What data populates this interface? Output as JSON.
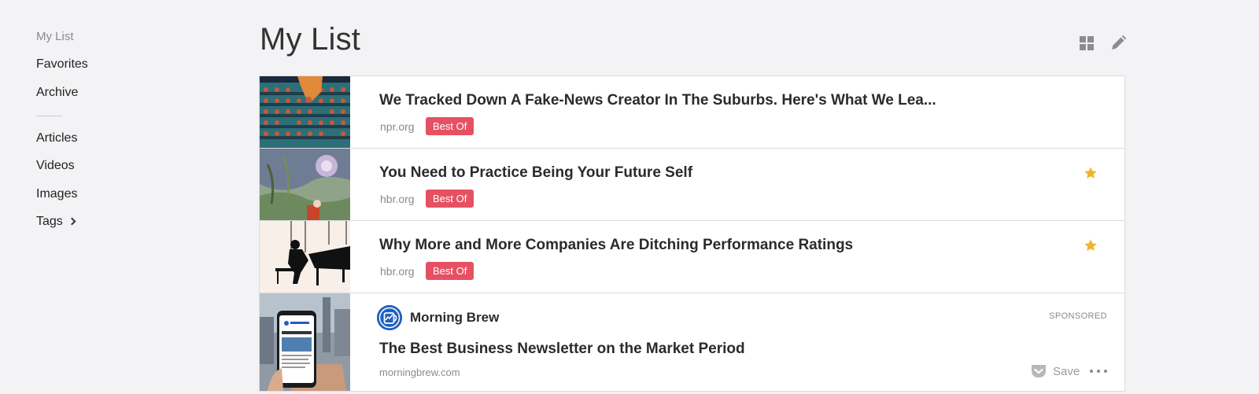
{
  "sidebar": {
    "items": [
      {
        "label": "My List",
        "active": true
      },
      {
        "label": "Favorites"
      },
      {
        "label": "Archive"
      },
      {
        "label": "Articles"
      },
      {
        "label": "Videos"
      },
      {
        "label": "Images"
      },
      {
        "label": "Tags"
      }
    ]
  },
  "header": {
    "title": "My List",
    "icons": [
      "grid-view-icon",
      "edit-icon"
    ]
  },
  "list": {
    "items": [
      {
        "title": "We Tracked Down A Fake-News Creator In The Suburbs. Here's What We Lea...",
        "domain": "npr.org",
        "badge": "Best Of",
        "favorited": false
      },
      {
        "title": "You Need to Practice Being Your Future Self",
        "domain": "hbr.org",
        "badge": "Best Of",
        "favorited": true
      },
      {
        "title": "Why More and More Companies Are Ditching Performance Ratings",
        "domain": "hbr.org",
        "badge": "Best Of",
        "favorited": true
      }
    ],
    "sponsored": {
      "brand": "Morning Brew",
      "label": "SPONSORED",
      "title": "The Best Business Newsletter on the Market Period",
      "domain": "morningbrew.com",
      "save_label": "Save"
    }
  },
  "colors": {
    "badge": "#e55163",
    "star": "#f0b429",
    "background": "#f3f3f5",
    "brand_blue": "#1f5fbf"
  }
}
